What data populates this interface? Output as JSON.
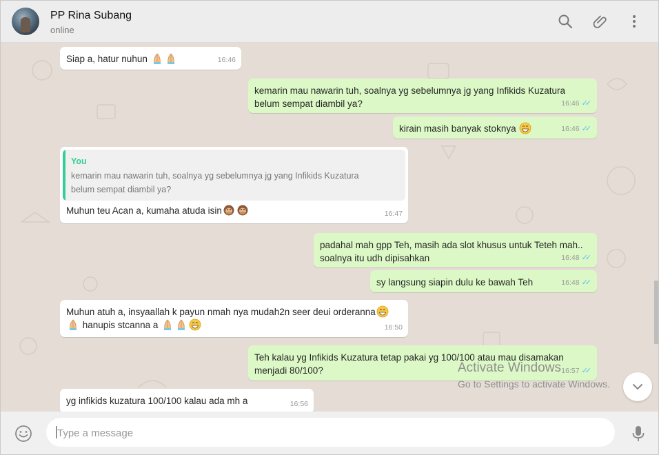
{
  "contact": {
    "name": "PP Rina Subang",
    "status": "online"
  },
  "header_icons": [
    "search-icon",
    "attach-icon",
    "menu-icon"
  ],
  "messages": [
    {
      "dir": "in",
      "text": "Siap a, hatur nuhun",
      "emoji": [
        "🙏🏼",
        "🙏🏼"
      ],
      "time": "16:46"
    },
    {
      "dir": "out",
      "lines": [
        "kemarin mau nawarin tuh, soalnya yg sebelumnya jg yang Infikids Kuzatura",
        "belum sempat diambil ya?"
      ],
      "time": "16:46",
      "read": true
    },
    {
      "dir": "out",
      "text": "kirain masih banyak stoknya",
      "emoji": [
        "😁"
      ],
      "time": "16:46",
      "read": true
    },
    {
      "dir": "in",
      "quote": {
        "author": "You",
        "lines": [
          "kemarin mau nawarin tuh, soalnya yg sebelumnya jg yang Infikids Kuzatura",
          "belum sempat diambil ya?"
        ]
      },
      "text": "Muhun teu Acan a, kumaha atuda isin",
      "emoji": [
        "🙊",
        "🙊"
      ],
      "time": "16:47"
    },
    {
      "dir": "out",
      "lines": [
        "padahal mah gpp Teh, masih ada slot khusus untuk Teteh mah..",
        "soalnya itu udh dipisahkan"
      ],
      "time": "16:48",
      "read": true
    },
    {
      "dir": "out",
      "text": "sy langsung siapin dulu ke bawah Teh",
      "time": "16:48",
      "read": true
    },
    {
      "dir": "in",
      "lines": [
        "Muhun atuh a, insyaallah k payun nmah nya mudah2n seer deui orderanna",
        "hanupis stcanna a"
      ],
      "time": "16:50"
    },
    {
      "dir": "out",
      "lines": [
        "Teh kalau yg Infikids Kuzatura tetap pakai yg 100/100 atau mau disamakan",
        "menjadi 80/100?"
      ],
      "time": "16:57",
      "read": true
    },
    {
      "dir": "in",
      "text": "yg infikids kuzatura 100/100 kalau ada mh a",
      "time": "16:56"
    }
  ],
  "composer": {
    "placeholder": "Type a message"
  },
  "watermark": {
    "title": "Activate Windows",
    "subtitle": "Go to Settings to activate Windows."
  },
  "colors": {
    "incoming": "#ffffff",
    "outgoing": "#dcf8c6",
    "read_ticks": "#4fc3f7",
    "quote_accent": "#35cd96"
  }
}
